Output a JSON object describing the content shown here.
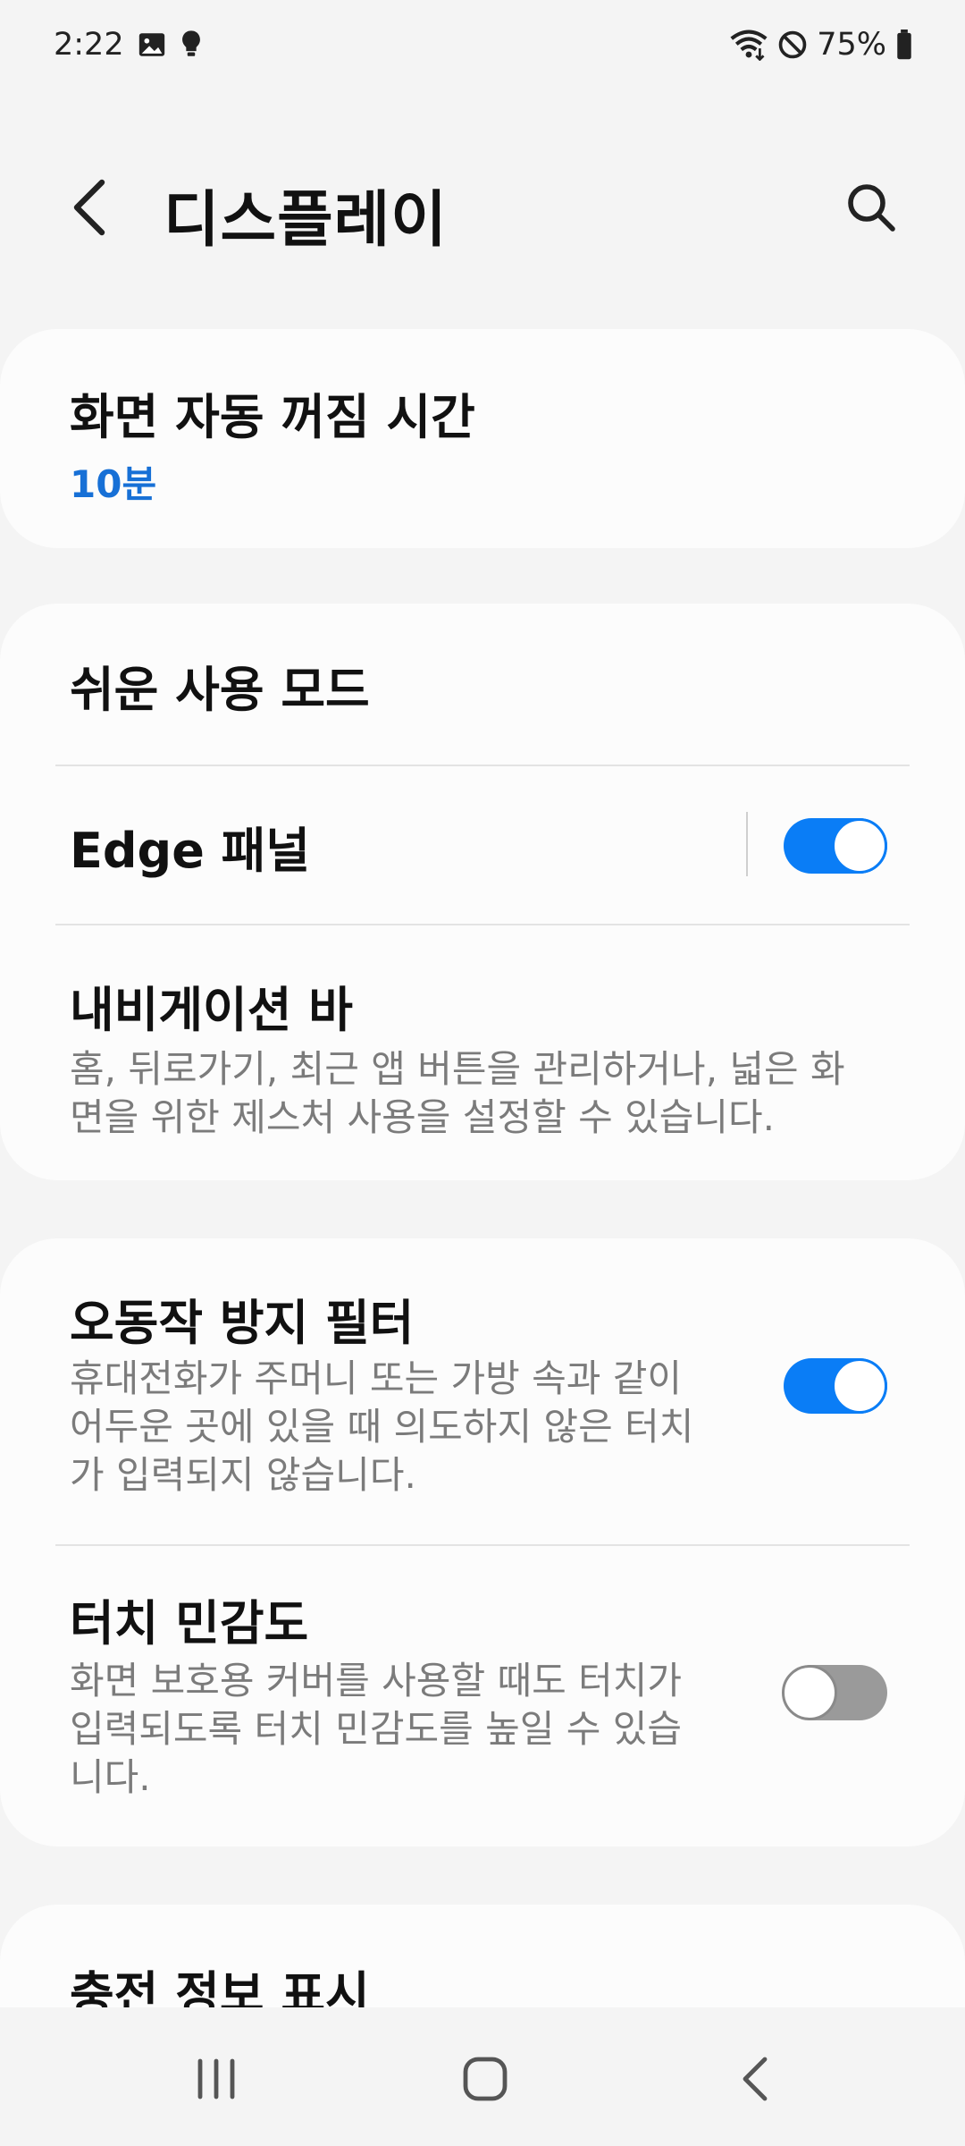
{
  "status_bar": {
    "time": "2:22",
    "battery_percent": "75%",
    "icons": [
      "gallery-icon",
      "bulb-icon",
      "wifi-icon",
      "do-not-disturb-icon",
      "battery-icon"
    ]
  },
  "header": {
    "title": "디스플레이",
    "back_icon": "back-chevron-icon",
    "search_icon": "search-icon"
  },
  "sections": {
    "screen_timeout": {
      "title": "화면 자동 꺼짐 시간",
      "value": "10분"
    },
    "easy_mode": {
      "title": "쉬운 사용 모드"
    },
    "edge_panel": {
      "title": "Edge 패널",
      "enabled": true
    },
    "navigation_bar": {
      "title": "내비게이션 바",
      "desc_line1": "홈, 뒤로가기, 최근 앱 버튼을 관리하거나, 넓은 화",
      "desc_line2": "면을 위한 제스처 사용을 설정할 수 있습니다."
    },
    "accidental_touch": {
      "title": "오동작 방지 필터",
      "desc_line1": "휴대전화가 주머니 또는 가방 속과 같이",
      "desc_line2": "어두운 곳에 있을 때 의도하지 않은 터치",
      "desc_line3": "가 입력되지 않습니다.",
      "enabled": true
    },
    "touch_sensitivity": {
      "title": "터치 민감도",
      "desc_line1": "화면 보호용 커버를 사용할 때도 터치가",
      "desc_line2": "입력되도록 터치 민감도를 높일 수 있습",
      "desc_line3": "니다.",
      "enabled": false
    },
    "charging_info": {
      "title": "충전 정보 표시"
    }
  },
  "nav_bar": {
    "icons": [
      "recents-icon",
      "home-icon",
      "back-icon"
    ]
  },
  "colors": {
    "accent": "#0a7df6",
    "value_blue": "#1770d6",
    "background": "#f4f4f4",
    "card": "#fcfcfc"
  }
}
